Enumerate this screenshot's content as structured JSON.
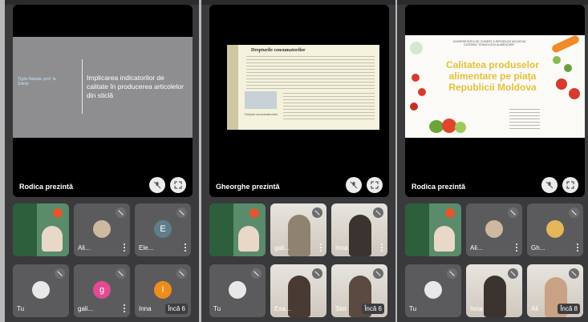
{
  "panels": [
    {
      "presenter": "Rodica prezintă",
      "slide": {
        "small_text": "Ţigăn Natalia, prof. la\nStiinte",
        "title": "Implicarea indicatorilor de calitate în producerea articolelor din sticlă"
      },
      "tiles": [
        {
          "kind": "cam",
          "name": "",
          "more": ""
        },
        {
          "kind": "cam-small",
          "name": "Ali...",
          "more": ""
        },
        {
          "kind": "letter",
          "letter": "E",
          "color": "#5f7e8c",
          "name": "Ele...",
          "more": ""
        },
        {
          "kind": "cam-small",
          "name": "Tu",
          "more": ""
        },
        {
          "kind": "letter",
          "letter": "g",
          "color": "#e24b93",
          "name": "gali...",
          "more": ""
        },
        {
          "kind": "letter",
          "letter": "I",
          "color": "#f08c1a",
          "name": "Inna",
          "more": "Încă 6"
        }
      ]
    },
    {
      "presenter": "Gheorghe prezintă",
      "slide": {
        "heading": "Drepturile consumatorilor",
        "caption": "Dreptul consumatorului"
      },
      "tiles": [
        {
          "kind": "cam",
          "name": "",
          "more": ""
        },
        {
          "kind": "cam",
          "name": "gali...",
          "more": ""
        },
        {
          "kind": "cam",
          "name": "Inna",
          "more": ""
        },
        {
          "kind": "cam-small",
          "name": "Tu",
          "more": ""
        },
        {
          "kind": "cam",
          "name": "Exa...",
          "more": ""
        },
        {
          "kind": "cam",
          "name": "Slot",
          "more": "Încă 6"
        }
      ]
    },
    {
      "presenter": "Rodica prezintă",
      "slide": {
        "header": "UNIVERSITATEA DE COMERŢ A REPUBLICII MOLDOVA\nCATEDRA \"TEHNOLOGII ALIMENTARE\"",
        "title": "Calitatea produselor alimentare pe piaţa Republicii Moldova"
      },
      "tiles": [
        {
          "kind": "cam",
          "name": "",
          "more": ""
        },
        {
          "kind": "cam-small",
          "name": "Ali...",
          "more": ""
        },
        {
          "kind": "cam-small",
          "name": "Gh...",
          "more": ""
        },
        {
          "kind": "cam-small",
          "name": "Tu",
          "more": ""
        },
        {
          "kind": "cam",
          "name": "Inna",
          "more": ""
        },
        {
          "kind": "cam",
          "name": "Ali",
          "more": "Încă 8"
        }
      ]
    }
  ]
}
